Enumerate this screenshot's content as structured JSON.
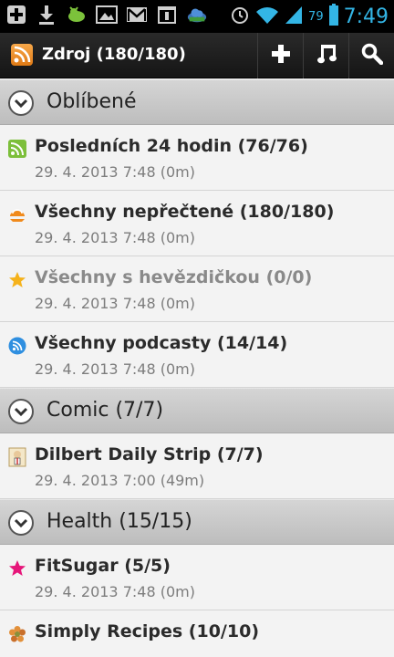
{
  "status_bar": {
    "battery_percent": "79",
    "time": "7:49",
    "icons": [
      "add-icon",
      "download-icon",
      "android-icon",
      "image-icon",
      "gmail-icon",
      "calendar-icon",
      "cloud-icon",
      "alarm-icon",
      "wifi-icon",
      "signal-icon",
      "battery-icon"
    ]
  },
  "action_bar": {
    "title": "Zdroj (180/180)",
    "actions": [
      "add-icon",
      "music-note-icon",
      "search-icon"
    ]
  },
  "groups": [
    {
      "title": "Oblíbené"
    },
    {
      "title": "Comic (7/7)"
    },
    {
      "title": "Health (15/15)"
    }
  ],
  "feeds": [
    {
      "title": "Posledních 24 hodin (76/76)",
      "date": "29. 4. 2013 7:48 (0m)",
      "icon": "rss-icon"
    },
    {
      "title": "Všechny nepřečtené (180/180)",
      "date": "29. 4. 2013 7:48 (0m)",
      "icon": "unread-stack-icon"
    },
    {
      "title": "Všechny s hevězdičkou (0/0)",
      "date": "29. 4. 2013 7:48 (0m)",
      "icon": "star-icon"
    },
    {
      "title": "Všechny podcasty (14/14)",
      "date": "29. 4. 2013 7:48 (0m)",
      "icon": "podcast-icon"
    },
    {
      "title": "Dilbert Daily Strip (7/7)",
      "date": "29. 4. 2013 7:00 (49m)",
      "icon": "dilbert-icon"
    },
    {
      "title": "FitSugar (5/5)",
      "date": "29. 4. 2013 7:48 (0m)",
      "icon": "pink-star-icon"
    },
    {
      "title": "Simply Recipes (10/10)",
      "date": "",
      "icon": "flower-icon"
    }
  ],
  "colors": {
    "accent": "#33b5e5",
    "rss_green": "#7cbf3a",
    "star_gold": "#f5b21b",
    "podcast_blue": "#2f8fe0",
    "fitsugar_pink": "#e6167a",
    "unread_orange": "#f08a1c"
  }
}
